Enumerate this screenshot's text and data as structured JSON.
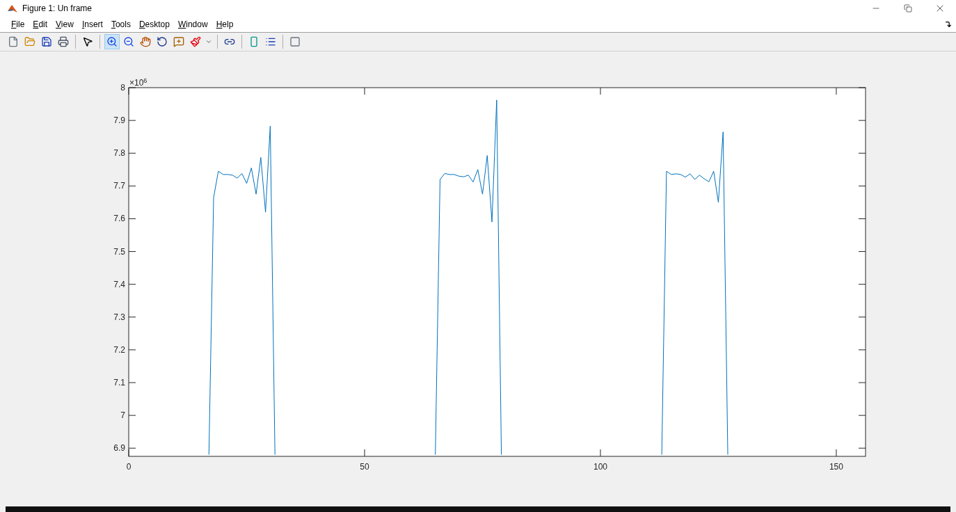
{
  "window": {
    "title": "Figure 1: Un frame"
  },
  "menu": [
    "File",
    "Edit",
    "View",
    "Insert",
    "Tools",
    "Desktop",
    "Window",
    "Help"
  ],
  "toolbar": [
    {
      "selected": false
    },
    {
      "selected": false
    },
    {
      "selected": false
    },
    {
      "selected": false
    },
    {
      "selected": false
    },
    {
      "selected": true
    },
    {
      "selected": false
    },
    {
      "selected": false
    },
    {
      "selected": false
    },
    {
      "selected": false
    },
    {
      "selected": false
    },
    {
      "selected": false
    },
    {
      "selected": false
    },
    {
      "selected": false
    },
    {
      "selected": false
    },
    {
      "selected": false
    }
  ],
  "figure": {
    "exponent": "×10$^{6}$",
    "chart_data": {
      "type": "line",
      "x": [
        17,
        18,
        19,
        20,
        21,
        22,
        23,
        24,
        25,
        26,
        27,
        28,
        29,
        30,
        31,
        65,
        66,
        67,
        68,
        69,
        70,
        71,
        72,
        73,
        74,
        75,
        76,
        77,
        78,
        79,
        113,
        114,
        115,
        116,
        117,
        118,
        119,
        120,
        121,
        122,
        123,
        124,
        125,
        126,
        127
      ],
      "series": [
        {
          "color": "#0072bd",
          "values": [
            6.88,
            7.665,
            7.745,
            7.735,
            7.735,
            7.733,
            7.724,
            7.738,
            7.708,
            7.755,
            7.675,
            7.787,
            7.62,
            7.883,
            6.88,
            6.88,
            7.72,
            7.738,
            7.735,
            7.735,
            7.73,
            7.728,
            7.733,
            7.712,
            7.75,
            7.675,
            7.793,
            7.59,
            7.962,
            6.88,
            6.88,
            7.745,
            7.735,
            7.737,
            7.735,
            7.727,
            7.737,
            7.72,
            7.733,
            7.722,
            7.713,
            7.745,
            7.65,
            7.865,
            6.88
          ]
        }
      ],
      "xlim": [
        0,
        156.2
      ],
      "ylim": [
        6.875,
        8
      ],
      "xticks": [
        0,
        50,
        100,
        150
      ],
      "yticks": [
        {
          "value": 6.9,
          "label": "6.9"
        },
        {
          "value": 7,
          "label": "7"
        },
        {
          "value": 7.1,
          "label": "7.1"
        },
        {
          "value": 7.2,
          "label": "7.2"
        },
        {
          "value": 7.3,
          "label": "7.3"
        },
        {
          "value": 7.4,
          "label": "7.4"
        },
        {
          "value": 7.5,
          "label": "7.5"
        },
        {
          "value": 7.6,
          "label": "7.6"
        },
        {
          "value": 7.7,
          "label": "7.7"
        },
        {
          "value": 7.8,
          "label": "7.8"
        },
        {
          "value": 7.9,
          "label": "7.9"
        },
        {
          "value": 8,
          "label": "8"
        }
      ]
    }
  }
}
